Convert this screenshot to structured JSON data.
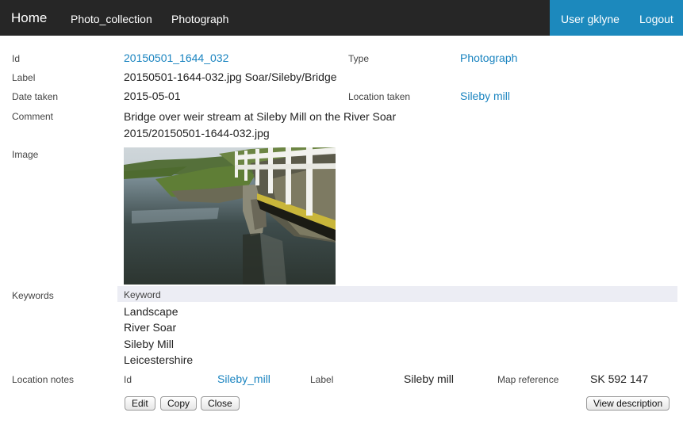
{
  "nav": {
    "brand": "Home",
    "links": [
      "Photo_collection",
      "Photograph"
    ],
    "user": "User gklyne",
    "logout": "Logout"
  },
  "fields": {
    "id_label": "Id",
    "id_value": "20150501_1644_032",
    "type_label": "Type",
    "type_value": "Photograph",
    "label_label": "Label",
    "label_value": "20150501-1644-032.jpg Soar/Sileby/Bridge",
    "date_label": "Date taken",
    "date_value": "2015-05-01",
    "location_label": "Location taken",
    "location_value": "Sileby mill",
    "comment_label": "Comment",
    "comment_line1": "Bridge over weir stream at Sileby Mill on the River Soar",
    "comment_line2": "2015/20150501-1644-032.jpg",
    "image_label": "Image"
  },
  "keywords": {
    "label": "Keywords",
    "column_header": "Keyword",
    "items": [
      "Landscape",
      "River Soar",
      "Sileby Mill",
      "Leicestershire"
    ]
  },
  "location_notes": {
    "label": "Location notes",
    "id_label": "Id",
    "id_value": "Sileby_mill",
    "label_label": "Label",
    "label_value": "Sileby mill",
    "mapref_label": "Map reference",
    "mapref_value": "SK 592 147"
  },
  "buttons": {
    "edit": "Edit",
    "copy": "Copy",
    "close": "Close",
    "view_description": "View description"
  },
  "colors": {
    "navbar": "#262626",
    "accent": "#1c89bd",
    "link": "#1a84c0",
    "keyword_header": "#ecedf4"
  }
}
